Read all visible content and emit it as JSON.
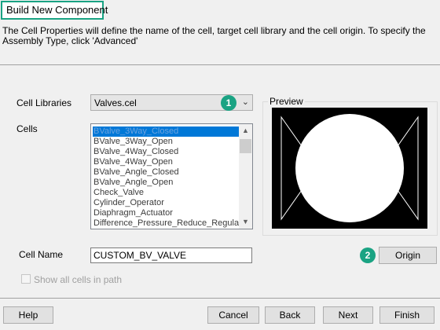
{
  "window": {
    "title": "Build New Component"
  },
  "description": "The Cell Properties will define the name of the cell, target cell library and the cell origin.  To specify the Assembly Type, click 'Advanced'",
  "cell_libraries": {
    "label": "Cell Libraries",
    "value": "Valves.cel"
  },
  "cells": {
    "label": "Cells",
    "items": [
      "BValve_3Way_Closed",
      "BValve_3Way_Open",
      "BValve_4Way_Closed",
      "BValve_4Way_Open",
      "BValve_Angle_Closed",
      "BValve_Angle_Open",
      "Check_Valve",
      "Cylinder_Operator",
      "Diaphragm_Actuator",
      "Difference_Pressure_Reduce_Regulat"
    ]
  },
  "preview": {
    "label": "Preview"
  },
  "cell_name": {
    "label": "Cell Name",
    "value": "CUSTOM_BV_VALVE"
  },
  "origin_button": "Origin",
  "show_all": {
    "label": "Show all cells in path",
    "checked": false
  },
  "badges": {
    "first": "1",
    "second": "2"
  },
  "buttons": {
    "help": "Help",
    "cancel": "Cancel",
    "back": "Back",
    "next": "Next",
    "finish": "Finish"
  },
  "colors": {
    "accent": "#1aa383",
    "selection": "#0078d7"
  }
}
